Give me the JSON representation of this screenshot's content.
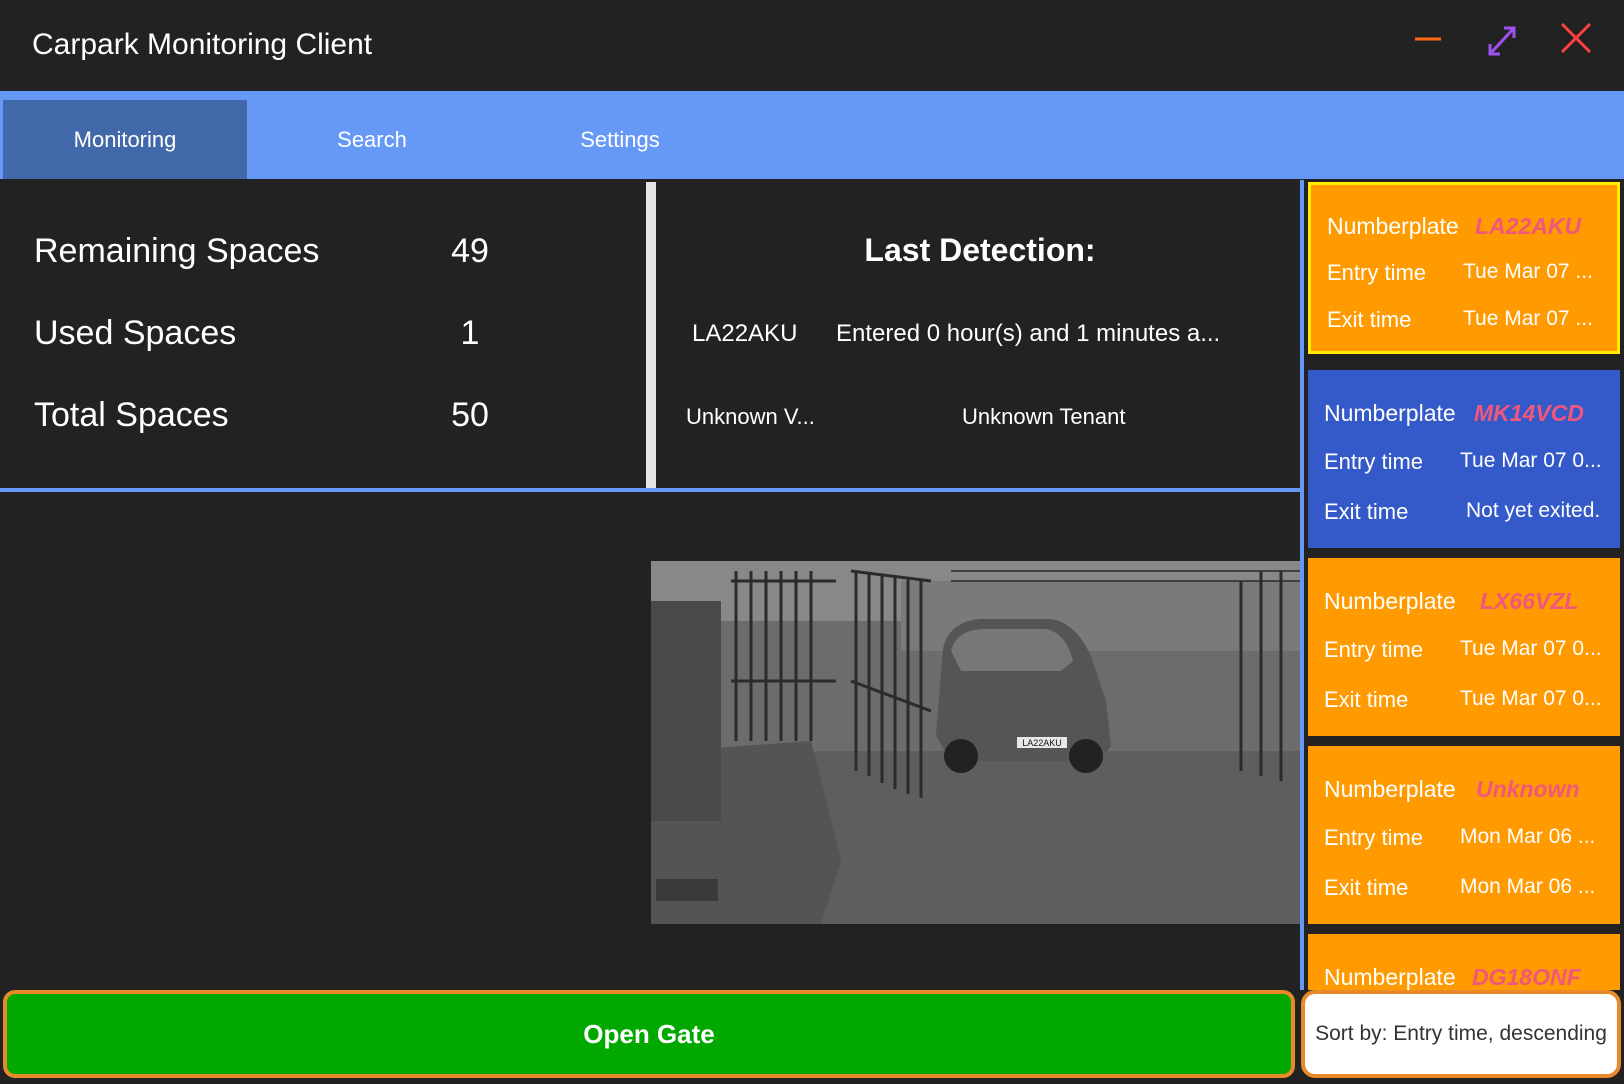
{
  "window": {
    "title": "Carpark Monitoring Client",
    "minimize_icon": "minimize-icon",
    "maximize_icon": "expand-icon",
    "close_icon": "close-icon"
  },
  "tabs": [
    {
      "label": "Monitoring",
      "active": true
    },
    {
      "label": "Search",
      "active": false
    },
    {
      "label": "Settings",
      "active": false
    }
  ],
  "stats": {
    "remaining_label": "Remaining Spaces",
    "remaining_value": "49",
    "used_label": "Used Spaces",
    "used_value": "1",
    "total_label": "Total Spaces",
    "total_value": "50"
  },
  "last_detection": {
    "heading": "Last Detection:",
    "plate": "LA22AKU",
    "status": "Entered 0 hour(s) and 1 minutes a...",
    "vehicle": "Unknown V...",
    "tenant": "Unknown Tenant"
  },
  "camera": {
    "plate_text": "LA22AKU"
  },
  "cards": [
    {
      "numberplate_label": "Numberplate",
      "numberplate": "LA22AKU",
      "entry_label": "Entry time",
      "entry_value": "Tue Mar 07 ...",
      "exit_label": "Exit time",
      "exit_value": "Tue Mar 07 ...",
      "color": "#ff9a00",
      "selected": true
    },
    {
      "numberplate_label": "Numberplate",
      "numberplate": "MK14VCD",
      "entry_label": "Entry time",
      "entry_value": "Tue Mar 07 0...",
      "exit_label": "Exit time",
      "exit_value": "Not yet exited.",
      "color": "#3459c8",
      "selected": false
    },
    {
      "numberplate_label": "Numberplate",
      "numberplate": "LX66VZL",
      "entry_label": "Entry time",
      "entry_value": "Tue Mar 07 0...",
      "exit_label": "Exit time",
      "exit_value": "Tue Mar 07 0...",
      "color": "#ff9a00",
      "selected": false
    },
    {
      "numberplate_label": "Numberplate",
      "numberplate": "Unknown",
      "entry_label": "Entry time",
      "entry_value": "Mon Mar 06 ...",
      "exit_label": "Exit time",
      "exit_value": "Mon Mar 06 ...",
      "color": "#ff9a00",
      "selected": false
    },
    {
      "numberplate_label": "Numberplate",
      "numberplate": "DG18ONF",
      "color": "#ff9a00",
      "selected": false
    }
  ],
  "actions": {
    "open_gate": "Open Gate",
    "sort_by": "Sort by: Entry time, descending"
  },
  "colors": {
    "accent": "#6699f5",
    "active_tab": "#4168a8",
    "card_orange": "#ff9a00",
    "card_blue": "#3459c8",
    "selected_border": "#ffee00",
    "plate_text": "#f0577a",
    "gate_green": "#00a800"
  }
}
